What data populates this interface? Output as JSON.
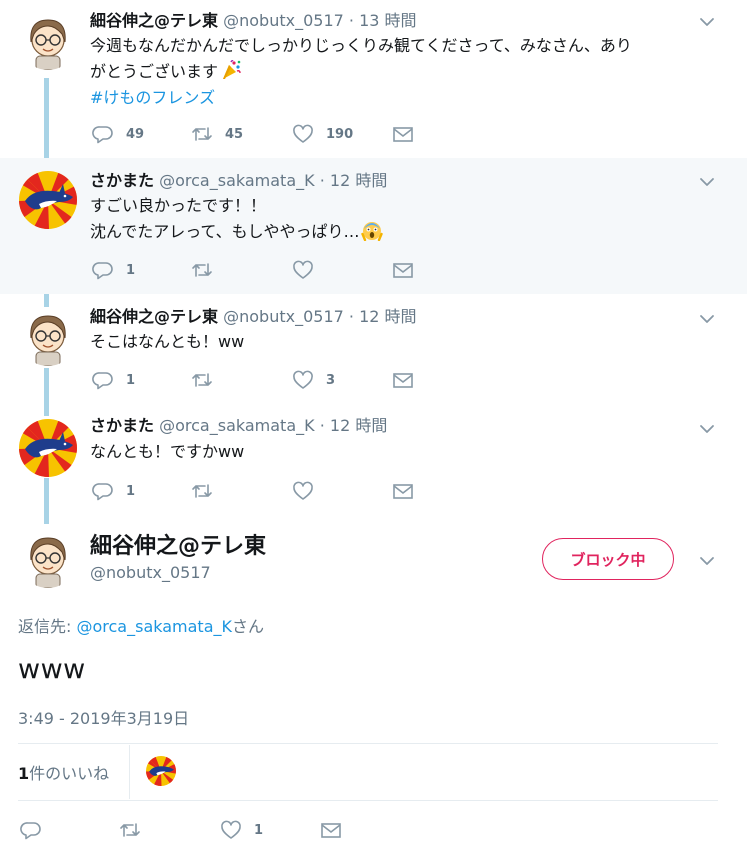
{
  "colors": {
    "link": "#1b95e0",
    "block": "#e0245e",
    "muted": "#657786",
    "thread_line": "#a8d3e6"
  },
  "tweets": [
    {
      "name": "細谷伸之@テレ東",
      "handle": "@nobutx_0517",
      "sep": "·",
      "time": "13 時間",
      "text_line1": "今週もなんだかんだでしっかりじっくりみ観てくださって、みなさん、あり",
      "text_line2": "がとうございます",
      "emoji": "party-popper",
      "hashtag": "#けものフレンズ",
      "reply_count": "49",
      "retweet_count": "45",
      "like_count": "190"
    },
    {
      "name": "さかまた",
      "handle": "@orca_sakamata_K",
      "sep": "·",
      "time": "12 時間",
      "text_line1": "すごい良かったです！！",
      "text_line2": "沈んでたアレって、もしややっぱり…",
      "emoji": "scream-face",
      "reply_count": "1",
      "retweet_count": "",
      "like_count": ""
    },
    {
      "name": "細谷伸之@テレ東",
      "handle": "@nobutx_0517",
      "sep": "·",
      "time": "12 時間",
      "text_line1": "そこはなんとも！ww",
      "reply_count": "1",
      "retweet_count": "",
      "like_count": "3"
    },
    {
      "name": "さかまた",
      "handle": "@orca_sakamata_K",
      "sep": "·",
      "time": "12 時間",
      "text_line1": "なんとも！ですかww",
      "reply_count": "1",
      "retweet_count": "",
      "like_count": ""
    }
  ],
  "main": {
    "name": "細谷伸之@テレ東",
    "handle": "@nobutx_0517",
    "block_label": "ブロック中",
    "reply_prefix": "返信先: ",
    "reply_mention": "@orca_sakamata_K",
    "reply_suffix": "さん",
    "text": "www",
    "timestamp": "3:49 - 2019年3月19日",
    "likes_count": "1",
    "likes_label": "件のいいね",
    "reply_count": "",
    "retweet_count": "",
    "like_count": "1"
  }
}
